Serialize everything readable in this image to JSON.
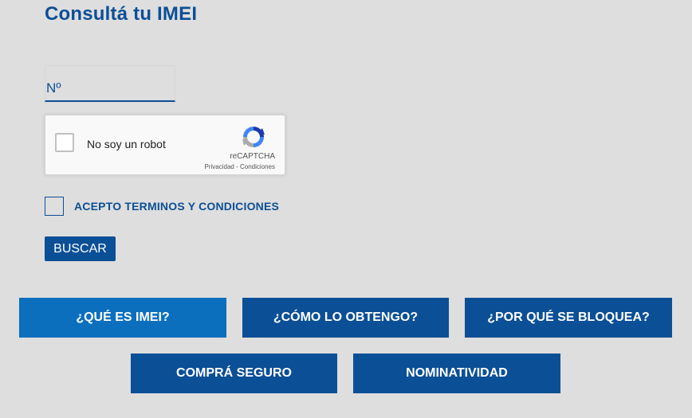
{
  "page": {
    "title": "Consultá tu IMEI"
  },
  "form": {
    "imei_placeholder": "Nº",
    "imei_value": "",
    "terms_label": "ACEPTO TERMINOS Y CONDICIONES",
    "terms_checked": false,
    "search_label": "BUSCAR"
  },
  "recaptcha": {
    "label": "No soy un robot",
    "brand": "reCAPTCHA",
    "terms": "Privacidad - Condiciones",
    "checked": false
  },
  "nav": {
    "que_es": "¿QUÉ ES IMEI?",
    "como": "¿CÓMO LO OBTENGO?",
    "porque": "¿POR QUÉ SE BLOQUEA?",
    "compra": "COMPRÁ SEGURO",
    "nominatividad": "NOMINATIVIDAD"
  },
  "colors": {
    "background": "#dedede",
    "primary": "#0b4f96",
    "active": "#0b6fbd"
  }
}
